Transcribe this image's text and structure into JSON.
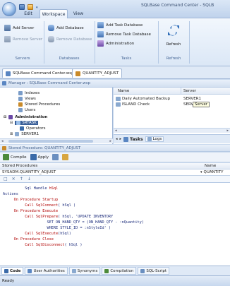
{
  "window": {
    "title": "SQLBase Command Center - SQLB"
  },
  "ribbon": {
    "tabs": [
      "Edit",
      "Workspace",
      "View"
    ],
    "active_tab": "Workspace",
    "groups": {
      "servers": {
        "label": "Servers",
        "add": "Add Server",
        "remove": "Remove Server"
      },
      "databases": {
        "label": "Databases",
        "add": "Add Database",
        "remove": "Remove Database"
      },
      "tasks": {
        "label": "Tasks",
        "add": "Add Task Database",
        "remove": "Remove Task Database",
        "admin": "Administration"
      },
      "refresh": {
        "label": "Refresh",
        "button": "Refresh"
      }
    }
  },
  "doc_tabs": [
    "SQLBase Command Center.wsp",
    "QUANTITY_ADJUST"
  ],
  "manager": {
    "path": "Manager : SQLBase Command Center.wsp",
    "tree": [
      "Indexes",
      "Views",
      "Stored Procedures",
      "Users",
      "Administration",
      "SRTASK",
      "Operators",
      "SERVER1"
    ],
    "grid": {
      "columns": [
        "Name",
        "Server"
      ],
      "rows": [
        {
          "name": "Daily Automated Backup",
          "server": "SERVER1"
        },
        {
          "name": "ISLAND Check",
          "server": "SERV"
        }
      ],
      "tooltip": "Server"
    },
    "tabs": {
      "tasks": "Tasks",
      "logs": "Logs"
    }
  },
  "stored_proc": {
    "path": "Stored Procedure: QUANTITY_ADJUST",
    "toolbar": {
      "compile": "Compile",
      "apply": "Apply"
    },
    "list_header": {
      "left": "Stored Procedures",
      "right": "Name"
    },
    "selected": {
      "name": "SYSADM.QUANTITY_ADJUST",
      "value": "QUANTITY"
    },
    "code": [
      {
        "indent": "          ",
        "segs": [
          [
            "navy",
            "Sql Handle "
          ],
          [
            "red",
            "hSql"
          ]
        ]
      },
      {
        "indent": "",
        "segs": [
          [
            "navy",
            "Actions"
          ]
        ]
      },
      {
        "indent": "     ",
        "segs": [
          [
            "red",
            "On Procedure Startup"
          ]
        ]
      },
      {
        "indent": "          ",
        "segs": [
          [
            "red",
            "Call SqlConnect"
          ],
          [
            "navy",
            "( hSql )"
          ]
        ]
      },
      {
        "indent": "     ",
        "segs": [
          [
            "red",
            "On Procedure Execute"
          ]
        ]
      },
      {
        "indent": "          ",
        "segs": [
          [
            "red",
            "Call SqlPrepare"
          ],
          [
            "navy",
            "( hSql, 'UPDATE INVENTORY"
          ]
        ]
      },
      {
        "indent": "                    ",
        "segs": [
          [
            "navy",
            "SET ON_HAND_QTY = (ON_HAND_QTY - :nQuantity)"
          ]
        ]
      },
      {
        "indent": "                    ",
        "segs": [
          [
            "navy",
            "WHERE STYLE_ID = :nStyleId' )"
          ]
        ]
      },
      {
        "indent": "          ",
        "segs": [
          [
            "red",
            "Call SqlExecute"
          ],
          [
            "navy",
            "(hSql)"
          ]
        ]
      },
      {
        "indent": "     ",
        "segs": [
          [
            "red",
            "On Procedure Close"
          ]
        ]
      },
      {
        "indent": "          ",
        "segs": [
          [
            "red",
            "Call SqlDisconnect"
          ],
          [
            "navy",
            "( hSql )"
          ]
        ]
      }
    ]
  },
  "bottom_tabs": [
    "Code",
    "User Authorities",
    "Synonyms",
    "Compilation",
    "SQL-Script"
  ],
  "active_bottom_tab": "Code",
  "status": "Ready",
  "colors": {
    "accent": "#3d6db0",
    "code_red": "#b00000",
    "code_navy": "#1a2a7a"
  }
}
